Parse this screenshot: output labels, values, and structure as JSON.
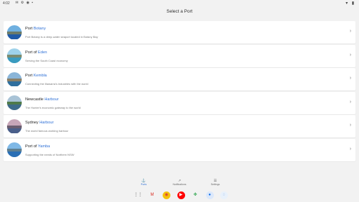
{
  "status_bar": {
    "time": "4:02",
    "icons": "✉ ⚙ ◉ ▪",
    "right_icons": "▾ ▮"
  },
  "header": {
    "title": "Select a Port"
  },
  "ports": [
    {
      "prefix": "Port ",
      "highlight": "Botany",
      "suffix": "",
      "subtitle": "Port Botany is a deep-water seaport located in Botany Bay",
      "colors": {
        "sky": "#6fb0e0",
        "land": "#6a7a6a",
        "water": "#1f5aa8"
      }
    },
    {
      "prefix": "Port of ",
      "highlight": "Eden",
      "suffix": "",
      "subtitle": "Serving the South Coast economy",
      "colors": {
        "sky": "#9fd2ea",
        "land": "#7c8c70",
        "water": "#3a9bbf"
      }
    },
    {
      "prefix": "Port ",
      "highlight": "Kembla",
      "suffix": "",
      "subtitle": "Connecting the Illawarra's industries with the world",
      "colors": {
        "sky": "#8ab5d8",
        "land": "#8a8068",
        "water": "#2f6f9e"
      }
    },
    {
      "prefix": "Newcastle ",
      "highlight": "Harbour",
      "suffix": "",
      "subtitle": "The Hunter's economic gateway to the world",
      "colors": {
        "sky": "#a9c3d6",
        "land": "#4f7a4a",
        "water": "#3e6b8a"
      }
    },
    {
      "prefix": "Sydney ",
      "highlight": "Harbour",
      "suffix": "",
      "subtitle": "The world famous working harbour",
      "colors": {
        "sky": "#c7a6b8",
        "land": "#6b5e70",
        "water": "#4a5f8a"
      }
    },
    {
      "prefix": "Port of ",
      "highlight": "Yamba",
      "suffix": "",
      "subtitle": "Supporting the needs of Northern NSW",
      "colors": {
        "sky": "#7fb8e6",
        "land": "#5f7f90",
        "water": "#2a6fb5"
      }
    }
  ],
  "bottom_nav": [
    {
      "label": "Ports",
      "icon": "anchor-icon",
      "glyph": "⚓",
      "active": true
    },
    {
      "label": "Notifications",
      "icon": "external-link-icon",
      "glyph": "↗",
      "active": false
    },
    {
      "label": "Settings",
      "icon": "sliders-icon",
      "glyph": "☰",
      "active": false
    }
  ],
  "dock": [
    {
      "icon": "app-grid-icon",
      "glyph": "⋮⋮",
      "bg": "transparent",
      "fg": "#333"
    },
    {
      "icon": "gmail-icon",
      "glyph": "M",
      "bg": "transparent",
      "fg": "#d93025"
    },
    {
      "icon": "chrome-icon",
      "glyph": "◉",
      "bg": "#f4c20d",
      "fg": "#db4437"
    },
    {
      "icon": "youtube-icon",
      "glyph": "▶",
      "bg": "#ff0000",
      "fg": "#ffffff"
    },
    {
      "icon": "photos-icon",
      "glyph": "✤",
      "bg": "transparent",
      "fg": "#34a853"
    },
    {
      "icon": "messages-icon",
      "glyph": "●",
      "bg": "#dbe8fb",
      "fg": "#1a73e8"
    },
    {
      "icon": "app-icon",
      "glyph": "◌",
      "bg": "#e8f1fb",
      "fg": "#5b8fd6"
    }
  ]
}
